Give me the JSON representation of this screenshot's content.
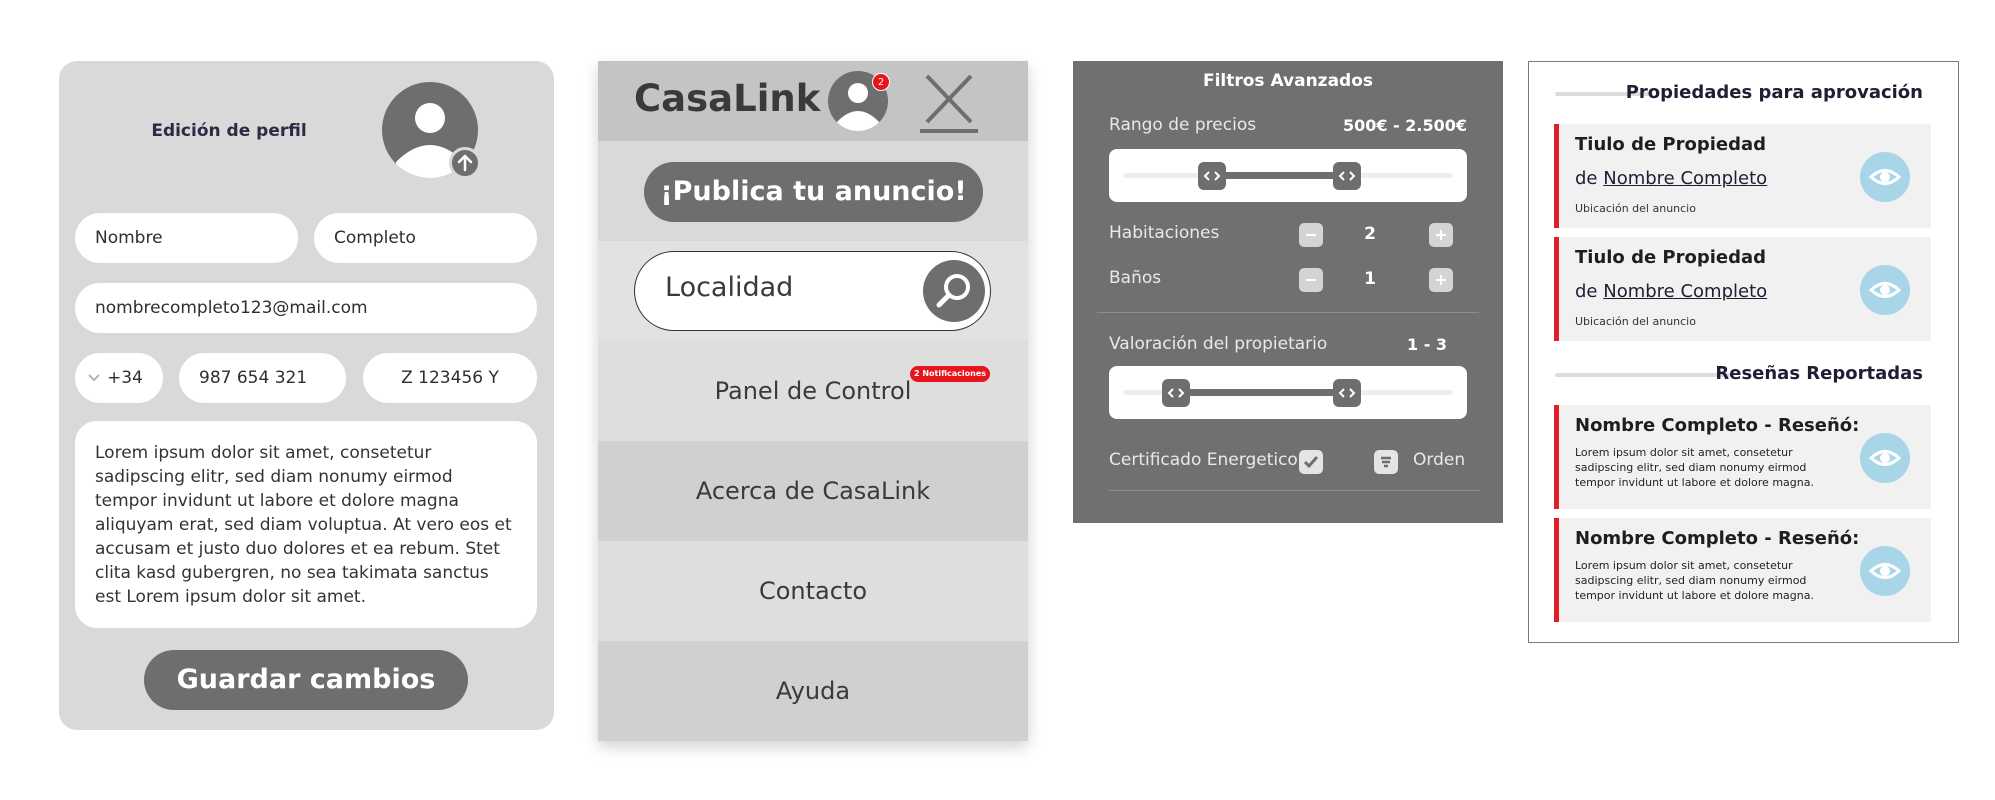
{
  "colors": {
    "accent_red": "#e11d25",
    "dark_gray": "#6e6e6e",
    "light_gray": "#d9d9d9",
    "eye_blue": "#a9d5e8"
  },
  "profile": {
    "title": "Edición de perfil",
    "first_name": "Nombre",
    "last_name": "Completo",
    "email": "nombrecompleto123@mail.com",
    "country_code": "+34",
    "phone": "987 654 321",
    "id_number": "Z 123456 Y",
    "bio": "Lorem ipsum dolor sit amet, consetetur sadipscing elitr, sed diam nonumy eirmod tempor invidunt ut labore et dolore magna aliquyam erat, sed diam voluptua. At vero eos et accusam et justo duo dolores et ea rebum. Stet clita kasd gubergren, no sea takimata sanctus est Lorem ipsum dolor sit amet.",
    "save_label": "Guardar cambios"
  },
  "menu": {
    "brand": "CasaLink",
    "avatar_badge": "2",
    "cta": "¡Publica tu anuncio!",
    "search_placeholder": "Localidad",
    "notifications_badge": "2 Notificaciones",
    "items": [
      "Panel de Control",
      "Acerca de CasaLink",
      "Contacto",
      "Ayuda"
    ]
  },
  "filters": {
    "title": "Filtros Avanzados",
    "price_label": "Rango de precios",
    "price_value": "500€ - 2.500€",
    "price_range_fraction": [
      0.27,
      0.68
    ],
    "rooms_label": "Habitaciones",
    "rooms_value": "2",
    "baths_label": "Baños",
    "baths_value": "1",
    "rating_label": "Valoración del propietario",
    "rating_value": "1 - 3",
    "rating_range_fraction": [
      0.16,
      0.68
    ],
    "cert_label": "Certificado Energetico",
    "cert_checked": true,
    "order_label": "Orden"
  },
  "approvals": {
    "properties_title": "Propiedades para aprovación",
    "properties": [
      {
        "title": "Tiulo de Propiedad",
        "by": "de",
        "owner": "Nombre Completo",
        "location": "Ubicación del anuncio"
      },
      {
        "title": "Tiulo de Propiedad",
        "by": "de",
        "owner": "Nombre Completo",
        "location": "Ubicación del anuncio"
      }
    ],
    "reviews_title": "Reseñas Reportadas",
    "reviews": [
      {
        "title": "Nombre Completo - Reseñó:",
        "body": "Lorem ipsum dolor sit amet, consetetur sadipscing elitr, sed diam nonumy eirmod tempor invidunt ut labore et dolore magna."
      },
      {
        "title": "Nombre Completo - Reseñó:",
        "body": "Lorem ipsum dolor sit amet, consetetur sadipscing elitr, sed diam nonumy eirmod tempor invidunt ut labore et dolore magna."
      }
    ]
  }
}
